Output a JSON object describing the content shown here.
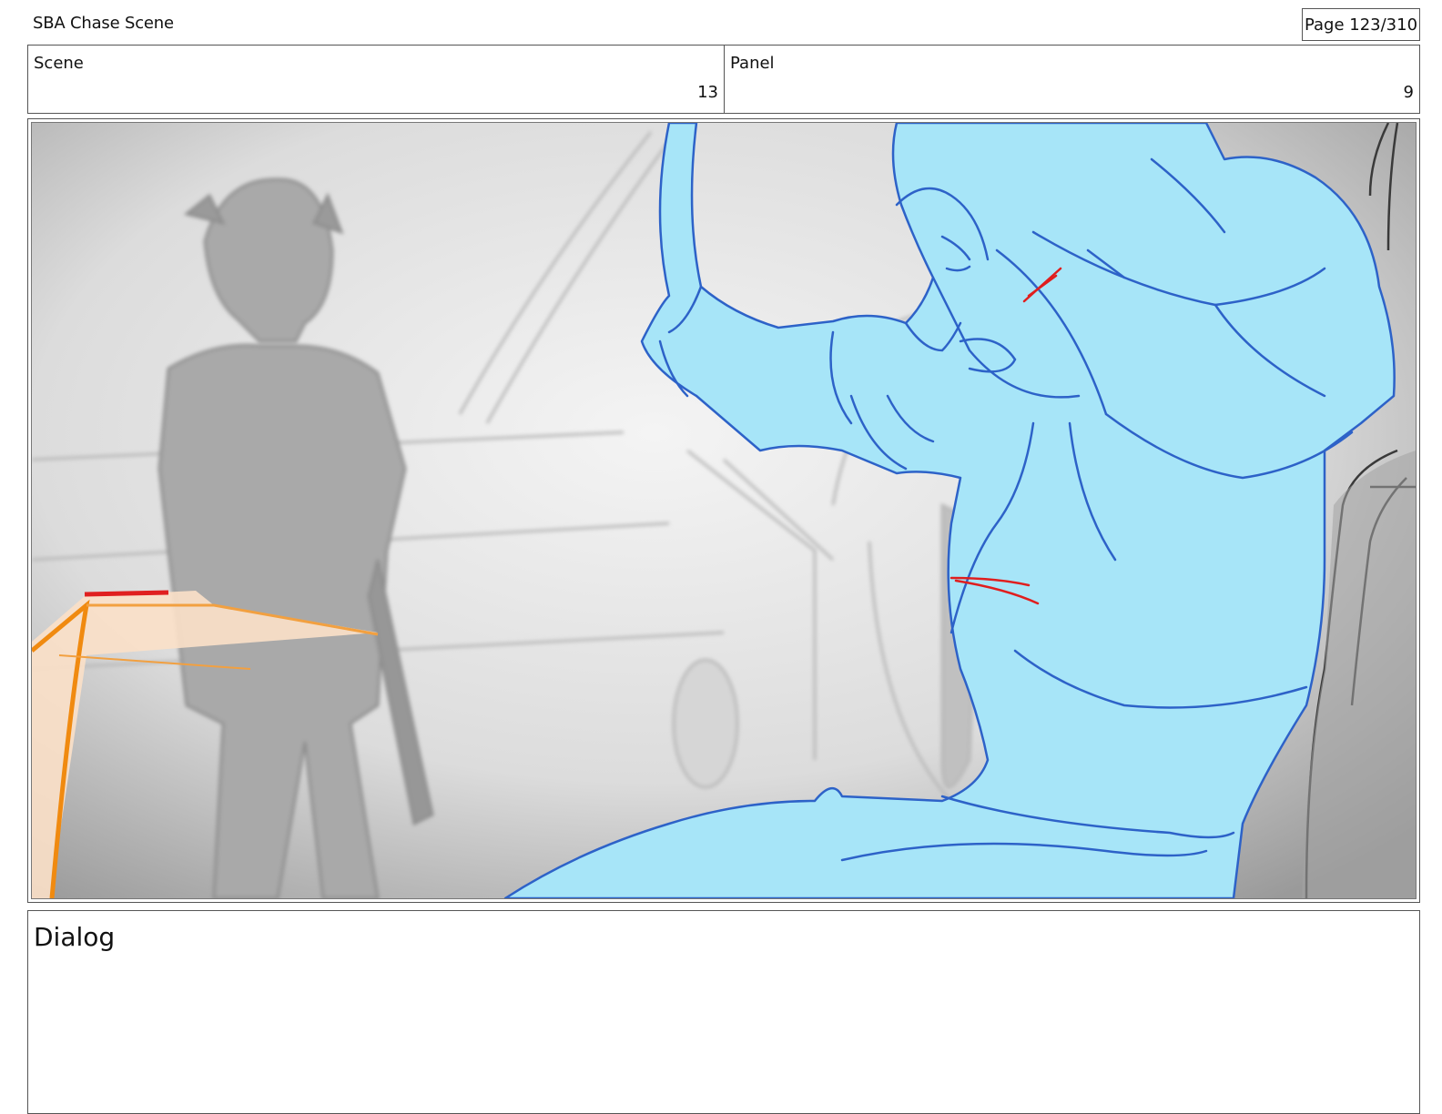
{
  "header": {
    "title": "SBA Chase Scene",
    "page": "Page 123/310"
  },
  "scene": {
    "label": "Scene",
    "value": "13"
  },
  "panel": {
    "label": "Panel",
    "value": "9"
  },
  "dialog": {
    "label": "Dialog"
  }
}
